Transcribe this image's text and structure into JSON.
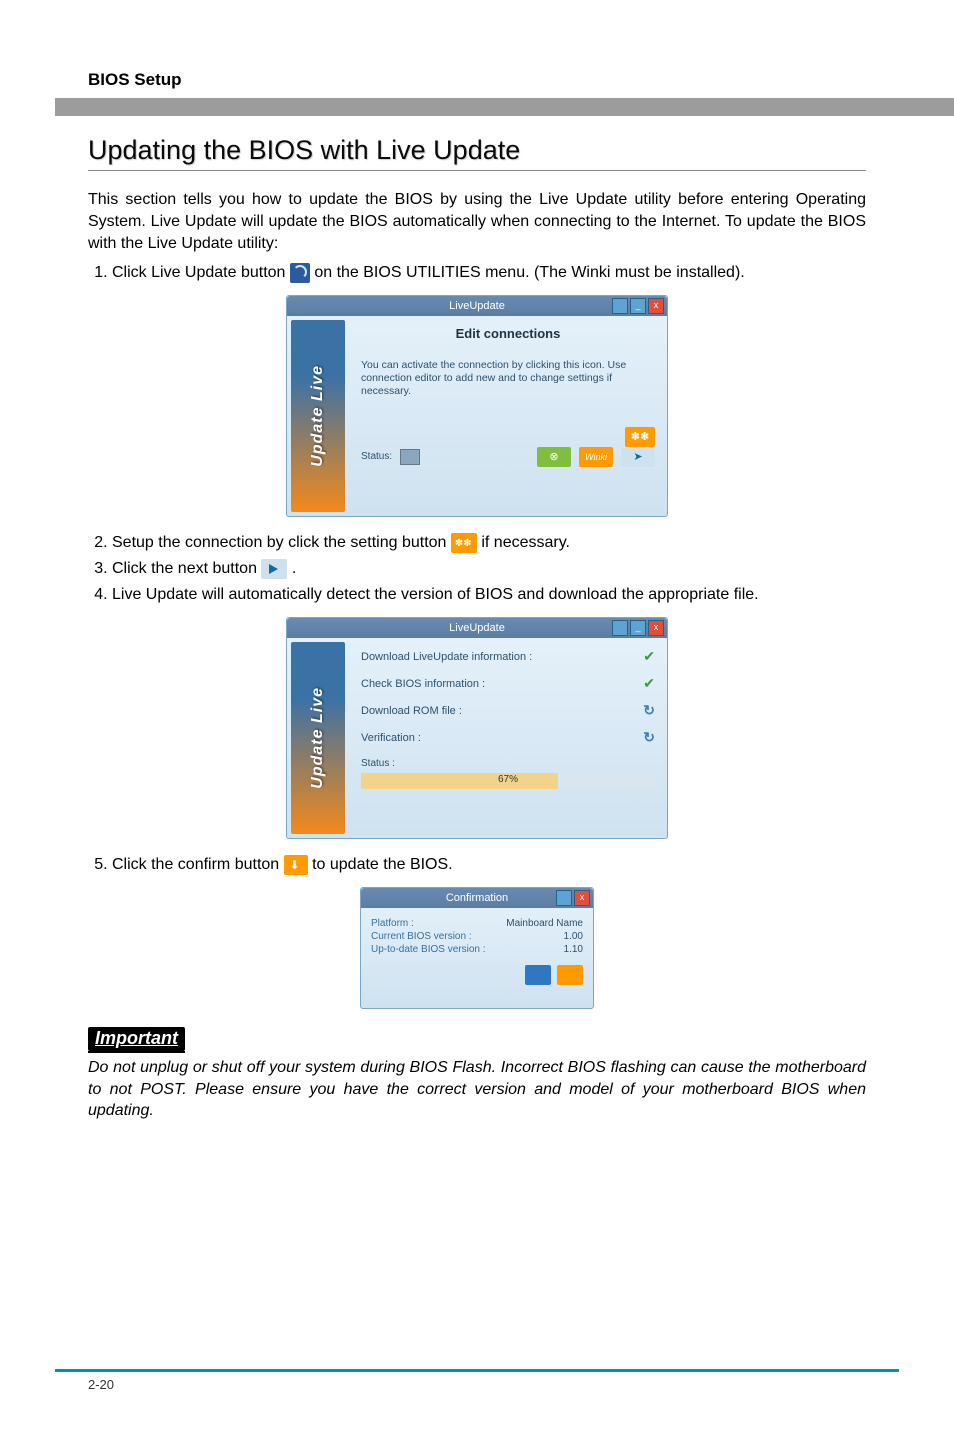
{
  "header": {
    "section": "BIOS Setup"
  },
  "page_number": "2-20",
  "title": "Updating the BIOS with Live Update",
  "intro": "This section tells you how to update the BIOS by using the Live Update utility before entering Operating System. Live Update will update the BIOS automatically when connecting to the Internet. To update the BIOS with the Live Update utility:",
  "steps_a": {
    "s1a": "Click Live Update button ",
    "s1b": " on the BIOS UTILITIES menu. (The Winki must be installed)."
  },
  "shot1": {
    "title": "LiveUpdate",
    "sidebar": "Update Live",
    "heading": "Edit connections",
    "note": "You can activate the connection by clicking this icon. Use connection editor to add new and to change settings if necessary.",
    "status_lbl": "Status:",
    "winki": "Winki"
  },
  "steps_b": {
    "s2a": "Setup the connection by click the setting button ",
    "s2b": " if necessary.",
    "s3a": "Click the next button ",
    "s3b": ".",
    "s4": "Live Update will automatically detect the version of BIOS and download the appropriate file."
  },
  "shot2": {
    "title": "LiveUpdate",
    "sidebar": "Update Live",
    "r1": "Download LiveUpdate information :",
    "r2": "Check BIOS information :",
    "r3": "Download ROM file :",
    "r4": "Verification :",
    "status_lbl": "Status :",
    "percent": "67%",
    "percent_num": 67
  },
  "steps_c": {
    "s5a": "Click the confirm button ",
    "s5b": " to update the BIOS."
  },
  "shot3": {
    "title": "Confirmation",
    "platform_lbl": "Platform :",
    "platform_val": "Mainboard Name",
    "cur_lbl": "Current BIOS version :",
    "cur_val": "1.00",
    "up_lbl": "Up-to-date BIOS version :",
    "up_val": "1.10"
  },
  "important_label": "Important",
  "important_note": "Do not unplug or shut off your system during BIOS Flash. Incorrect BIOS flashing can cause the motherboard to not POST. Please ensure you have the correct version and model of your motherboard BIOS when updating."
}
